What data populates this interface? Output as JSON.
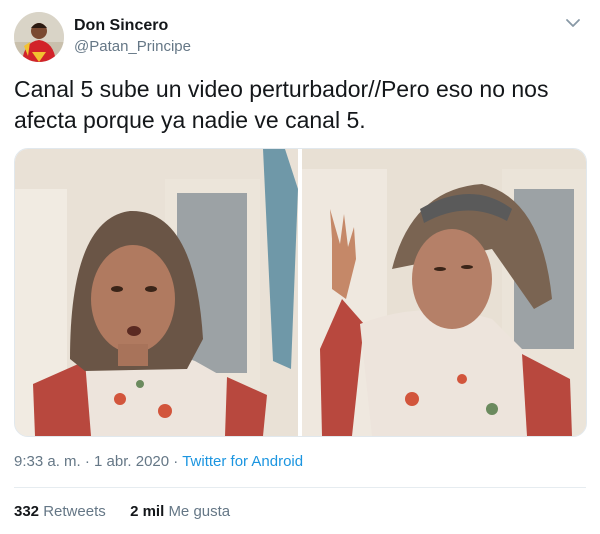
{
  "tweet": {
    "display_name": "Don Sincero",
    "handle": "@Patan_Principe",
    "text": "Canal 5 sube un video perturbador//Pero eso no nos afecta porque ya nadie ve canal 5.",
    "time": "9:33 a. m.",
    "separator": "·",
    "date": "1 abr. 2020",
    "source": "Twitter for Android"
  },
  "stats": {
    "retweets_count": "332",
    "retweets_label": "Retweets",
    "likes_count": "2 mil",
    "likes_label": "Me gusta"
  },
  "icons": {
    "menu": "chevron-down-icon",
    "avatar": "avatar-image"
  },
  "colors": {
    "link": "#1b95e0",
    "secondary_text": "#657786",
    "primary_text": "#14171a",
    "divider": "#e6ecf0"
  }
}
